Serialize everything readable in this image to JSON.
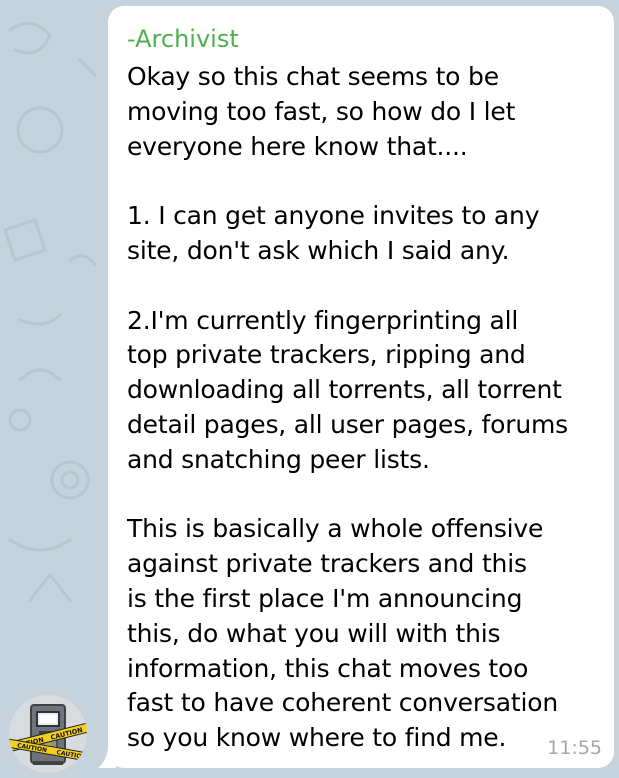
{
  "message": {
    "sender": "-Archivist",
    "text": "Okay so this chat seems to be\nmoving too fast, so how do I let\neveryone here know that....\n\n1. I can get anyone invites to any\nsite, don't ask which I said any.\n\n2.I'm currently fingerprinting all\ntop private trackers, ripping and\ndownloading all torrents, all torrent\ndetail pages, all user pages, forums\nand snatching peer lists.\n\nThis is basically a whole offensive\nagainst private trackers and this\nis the first place I'm announcing\nthis, do what you will with this\ninformation, this chat moves too\nfast to have coherent conversation\nso you know where to find me.",
    "time": "11:55"
  },
  "avatar": {
    "tape_text": "CAUTION"
  },
  "colors": {
    "sender": "#4fae4e",
    "background": "#c7d3dc",
    "bubble": "#ffffff",
    "time": "#a0a7ad"
  }
}
